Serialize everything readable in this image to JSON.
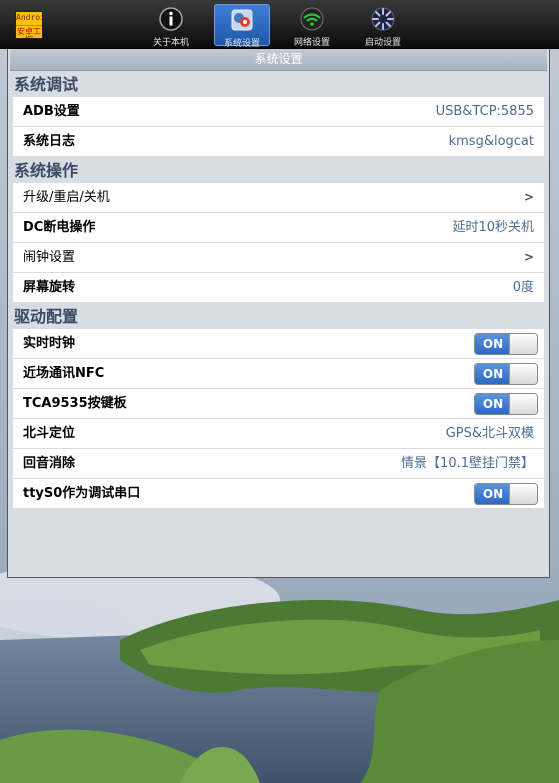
{
  "toolbar": {
    "logo": {
      "line1": "AndroidEmb",
      "line2": "安卓工控"
    },
    "tabs": [
      {
        "label": "关于本机",
        "icon": "info-icon",
        "active": false
      },
      {
        "label": "系统设置",
        "icon": "system-settings-icon",
        "active": true
      },
      {
        "label": "网络设置",
        "icon": "wifi-icon",
        "active": false
      },
      {
        "label": "启动设置",
        "icon": "startup-spinner-icon",
        "active": false
      }
    ]
  },
  "panel": {
    "title": "系统设置",
    "sections": [
      {
        "header": "系统调试",
        "rows": [
          {
            "label": "ADB设置",
            "value": "USB&TCP:5855"
          },
          {
            "label": "系统日志",
            "value": "kmsg&logcat"
          }
        ]
      },
      {
        "header": "系统操作",
        "rows": [
          {
            "label": "升级/重启/关机",
            "chevron": ">"
          },
          {
            "label": "DC断电操作",
            "value": "延时10秒关机"
          },
          {
            "label": "闹钟设置",
            "chevron": ">"
          },
          {
            "label": "屏幕旋转",
            "value": "0度"
          }
        ]
      },
      {
        "header": "驱动配置",
        "rows": [
          {
            "label": "实时时钟",
            "toggle": "ON"
          },
          {
            "label": "近场通讯NFC",
            "toggle": "ON"
          },
          {
            "label": "TCA9535按键板",
            "toggle": "ON"
          },
          {
            "label": "北斗定位",
            "value": "GPS&北斗双模"
          },
          {
            "label": "回音消除",
            "value": "情景【10.1壁挂门禁】"
          },
          {
            "label": "ttyS0作为调试串口",
            "toggle": "ON"
          }
        ]
      }
    ]
  },
  "colors": {
    "accent": "#2c68c4",
    "value_text": "#4e6c94",
    "section_header": "#3b4a64"
  }
}
